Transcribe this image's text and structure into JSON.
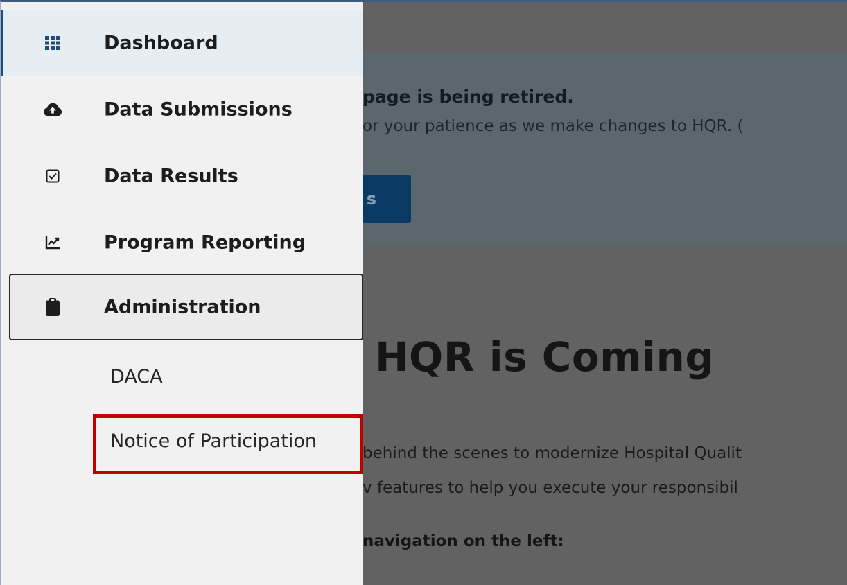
{
  "sidebar": {
    "items": [
      {
        "label": "Dashboard",
        "icon": "grid-icon"
      },
      {
        "label": "Data Submissions",
        "icon": "cloud-upload-icon"
      },
      {
        "label": "Data Results",
        "icon": "checkbox-icon"
      },
      {
        "label": "Program Reporting",
        "icon": "chart-line-icon"
      },
      {
        "label": "Administration",
        "icon": "clipboard-icon"
      }
    ],
    "sub_items": [
      {
        "label": "DACA"
      },
      {
        "label": "Notice of Participation"
      }
    ]
  },
  "main": {
    "banner": {
      "title": "page is being retired.",
      "text": "or your patience as we make changes to HQR. (",
      "button_label": "s"
    },
    "hero_title": "HQR is Coming",
    "body_lines": [
      "behind the scenes to modernize Hospital Qualit",
      "v features to help you execute your responsibil"
    ],
    "subhead": "navigation on the left:"
  },
  "colors": {
    "accent": "#1f4e79",
    "highlight": "#c00000",
    "overlay": "#626262",
    "sidebar_bg": "#f1f1f1"
  }
}
